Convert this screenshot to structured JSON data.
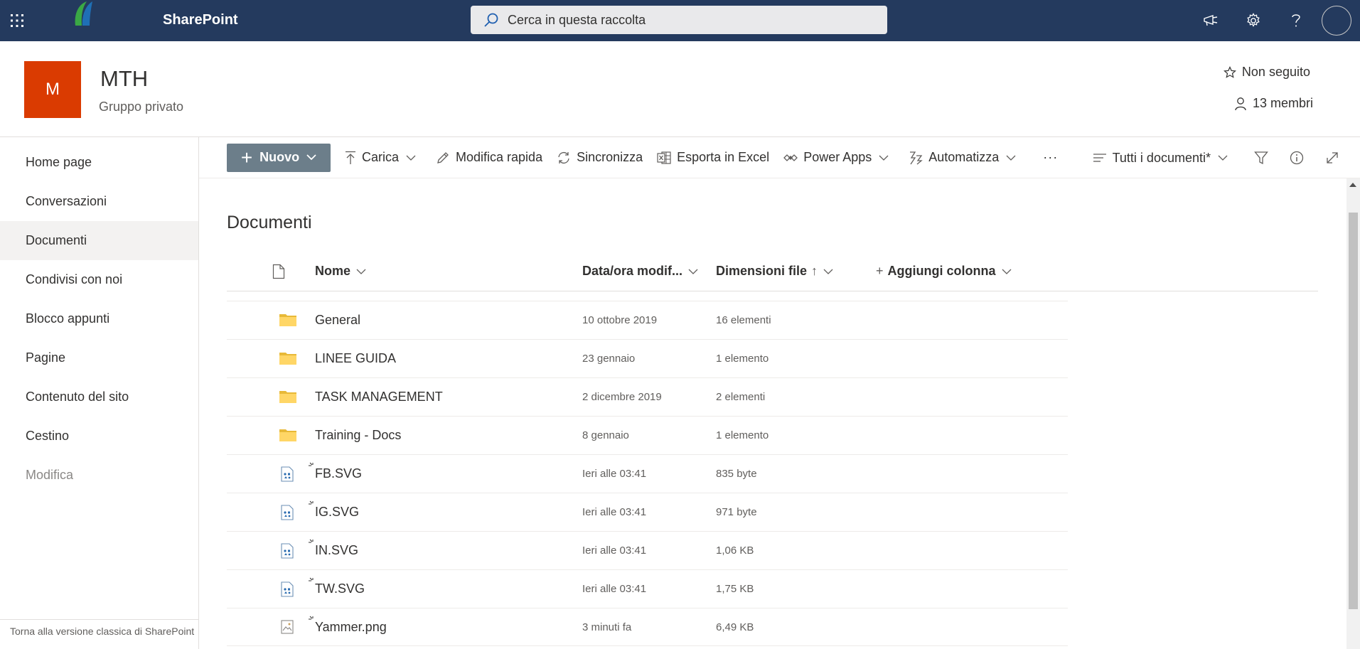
{
  "suite": {
    "app_name": "SharePoint",
    "search_placeholder": "Cerca in questa raccolta"
  },
  "site": {
    "logo_letter": "M",
    "title": "MTH",
    "subtitle": "Gruppo privato",
    "follow_label": "Non seguito",
    "members_label": "13 membri"
  },
  "nav": {
    "items": [
      {
        "label": "Home page"
      },
      {
        "label": "Conversazioni"
      },
      {
        "label": "Documenti"
      },
      {
        "label": "Condivisi con noi"
      },
      {
        "label": "Blocco appunti"
      },
      {
        "label": "Pagine"
      },
      {
        "label": "Contenuto del sito"
      },
      {
        "label": "Cestino"
      },
      {
        "label": "Modifica"
      }
    ],
    "classic_link": "Torna alla versione classica di SharePoint"
  },
  "commands": {
    "new": "Nuovo",
    "upload": "Carica",
    "quick_edit": "Modifica rapida",
    "sync": "Sincronizza",
    "export": "Esporta in Excel",
    "power_apps": "Power Apps",
    "automate": "Automatizza",
    "more": "···",
    "view": "Tutti i documenti*"
  },
  "library": {
    "title": "Documenti",
    "columns": {
      "name": "Nome",
      "modified": "Data/ora modif...",
      "size": "Dimensioni file",
      "size_sort": "↑",
      "add": "Aggiungi colonna"
    },
    "rows": [
      {
        "type": "folder",
        "name": "General",
        "modified": "10 ottobre 2019",
        "size": "16 elementi"
      },
      {
        "type": "folder",
        "name": "LINEE GUIDA",
        "modified": "23 gennaio",
        "size": "1 elemento"
      },
      {
        "type": "folder",
        "name": "TASK MANAGEMENT",
        "modified": "2 dicembre 2019",
        "size": "2 elementi"
      },
      {
        "type": "folder",
        "name": "Training - Docs",
        "modified": "8 gennaio",
        "size": "1 elemento"
      },
      {
        "type": "svg",
        "name": "FB.SVG",
        "modified": "Ieri alle 03:41",
        "size": "835 byte"
      },
      {
        "type": "svg",
        "name": "IG.SVG",
        "modified": "Ieri alle 03:41",
        "size": "971 byte"
      },
      {
        "type": "svg",
        "name": "IN.SVG",
        "modified": "Ieri alle 03:41",
        "size": "1,06 KB"
      },
      {
        "type": "svg",
        "name": "TW.SVG",
        "modified": "Ieri alle 03:41",
        "size": "1,75 KB"
      },
      {
        "type": "image",
        "name": "Yammer.png",
        "modified": "3 minuti fa",
        "size": "6,49 KB"
      }
    ]
  },
  "colors": {
    "suite_bar": "#243a5e",
    "site_logo": "#da3b01",
    "new_button": "#6c7e8a",
    "folder": "#ffd666"
  }
}
